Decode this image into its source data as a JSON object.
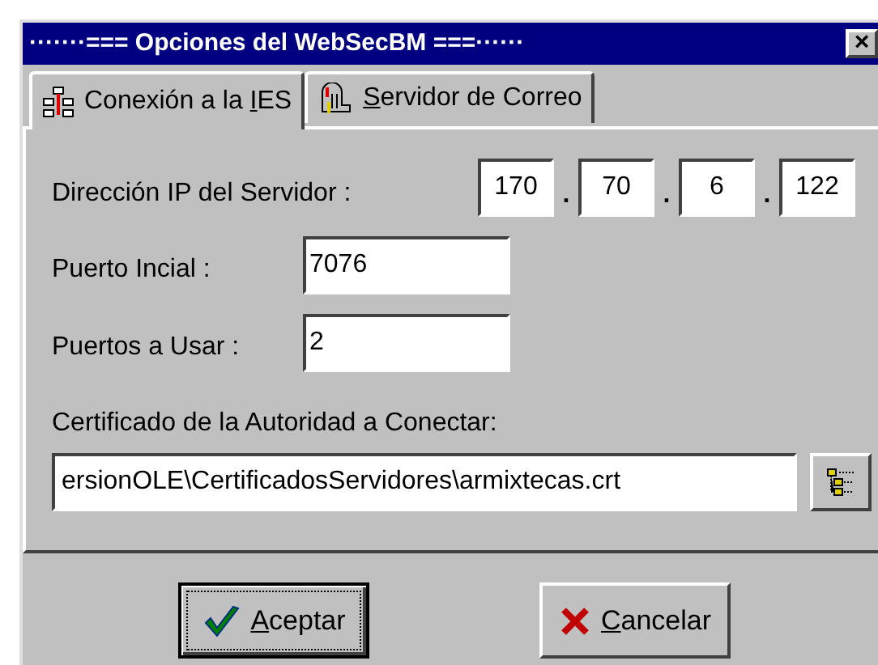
{
  "window": {
    "title": "·······=== Opciones del WebSecBM ===······",
    "close": "×"
  },
  "tabs": [
    {
      "label": {
        "before": "Conexión a la ",
        "key": "I",
        "after": "ES"
      },
      "selected": true
    },
    {
      "label": {
        "key": "S",
        "after": "ervidor de Correo"
      },
      "selected": false
    }
  ],
  "ip": {
    "label": "Dirección IP del Servidor :",
    "octets": [
      "170",
      "70",
      "6",
      "122"
    ],
    "separator": "."
  },
  "fields": [
    {
      "label": "Puerto Incial :",
      "value": "7076"
    },
    {
      "label": "Puertos a Usar :",
      "value": "2"
    }
  ],
  "certificate": {
    "label": "Certificado de la Autoridad a Conectar:",
    "value": "ersionOLE\\CertificadosServidores\\armixtecas.crt"
  },
  "buttons": [
    {
      "label": {
        "key": "A",
        "after": "ceptar"
      },
      "default": true
    },
    {
      "label": {
        "key": "C",
        "after": "ancelar"
      },
      "default": false
    }
  ]
}
